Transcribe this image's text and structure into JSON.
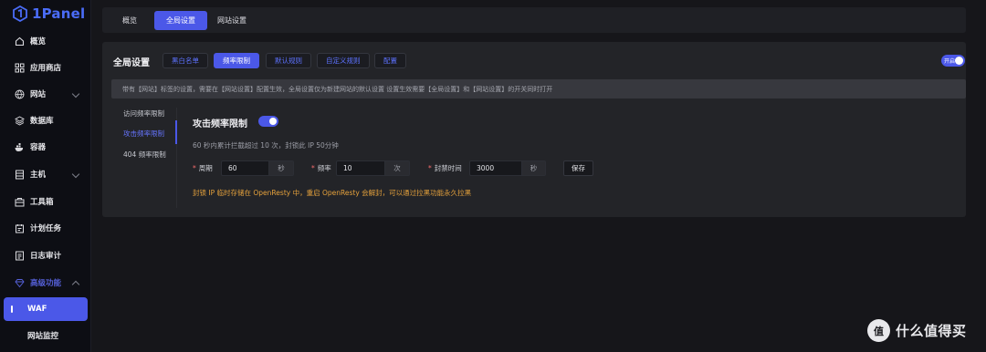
{
  "app": {
    "logo_text": "1Panel"
  },
  "sidebar": {
    "items": [
      {
        "label": "概览",
        "icon": "home-icon"
      },
      {
        "label": "应用商店",
        "icon": "grid-icon"
      },
      {
        "label": "网站",
        "icon": "globe-icon"
      },
      {
        "label": "数据库",
        "icon": "database-icon"
      },
      {
        "label": "容器",
        "icon": "docker-icon"
      },
      {
        "label": "主机",
        "icon": "server-icon"
      },
      {
        "label": "工具箱",
        "icon": "toolbox-icon"
      },
      {
        "label": "计划任务",
        "icon": "calendar-icon"
      },
      {
        "label": "日志审计",
        "icon": "log-icon"
      },
      {
        "label": "高级功能",
        "icon": "diamond-icon"
      }
    ],
    "sub_items": [
      {
        "label": "WAF"
      },
      {
        "label": "网站监控"
      }
    ]
  },
  "top_tabs": [
    {
      "label": "概览"
    },
    {
      "label": "全局设置"
    },
    {
      "label": "网站设置"
    }
  ],
  "panel": {
    "title": "全局设置",
    "sub_tabs": [
      {
        "label": "黑白名单"
      },
      {
        "label": "频率限制"
      },
      {
        "label": "默认规则"
      },
      {
        "label": "自定义规则"
      },
      {
        "label": "配置"
      }
    ],
    "toggle_label": "开启",
    "notice": "带有【网站】标签的设置，需要在【网站设置】配置生效，全局设置仅为新建网站的默认设置 设置生效需要【全局设置】和【网站设置】的开关同时打开",
    "side_menu": [
      {
        "label": "访问频率限制"
      },
      {
        "label": "攻击频率限制"
      },
      {
        "label": "404 频率限制"
      }
    ],
    "section_title": "攻击频率限制",
    "description": "60 秒内累计拦截超过 10 次，封锁此 IP 50分钟",
    "fields": {
      "period": {
        "label": "周期",
        "value": "60",
        "unit": "秒"
      },
      "frequency": {
        "label": "频率",
        "value": "10",
        "unit": "次"
      },
      "ban_time": {
        "label": "封禁时间",
        "value": "3000",
        "unit": "秒"
      }
    },
    "save_label": "保存",
    "warning": "封锁 IP 临时存储在 OpenResty 中，重启 OpenResty 会解封，可以通过拉黑功能永久拉黑"
  },
  "watermark": {
    "badge": "值",
    "text": "什么值得买"
  },
  "colors": {
    "accent": "#4b58e8",
    "warning": "#e6a23c",
    "background": "#16161a"
  }
}
